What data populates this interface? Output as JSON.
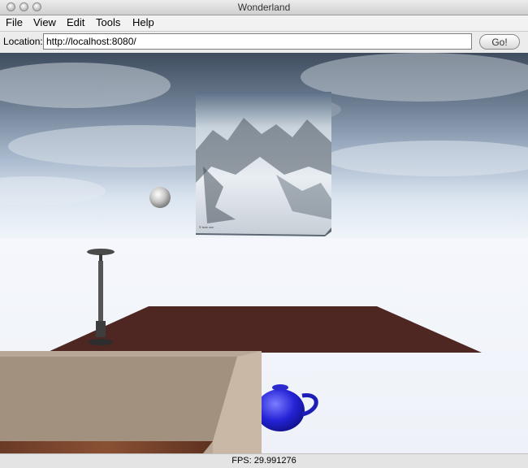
{
  "window": {
    "title": "Wonderland"
  },
  "menu": {
    "items": [
      {
        "label": "File"
      },
      {
        "label": "View"
      },
      {
        "label": "Edit"
      },
      {
        "label": "Tools"
      },
      {
        "label": "Help"
      }
    ]
  },
  "toolbar": {
    "location_label": "Location:",
    "location_value": "http://localhost:8080/",
    "go_label": "Go!"
  },
  "scene": {
    "photo_caption": "© bob xxx"
  },
  "status": {
    "fps": "FPS: 29.991276"
  }
}
